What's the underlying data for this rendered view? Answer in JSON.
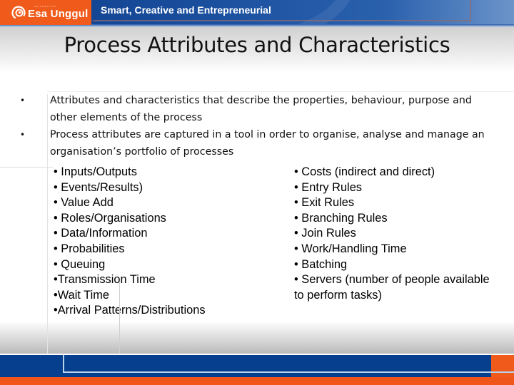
{
  "header": {
    "logo_text": "Esa Unggul",
    "logo_subtext": "UNIVERSITAS",
    "tagline": "Smart, Creative and Entrepreneurial",
    "logo_icon": "esa-unggul-logo-icon",
    "colors": {
      "brand_orange": "#f05a1a",
      "brand_blue": "#063f8d"
    }
  },
  "slide": {
    "title": "Process Attributes and Characteristics",
    "bullets": [
      {
        "marker": "•",
        "text": "Attributes and characteristics that describe the properties, behaviour, purpose and other elements of the process"
      },
      {
        "marker": "•",
        "text": "Process attributes are captured in a tool in order to organise, analyse and manage an organisation’s portfolio of processes"
      }
    ],
    "left_list": [
      "• Inputs/Outputs",
      "• Events/Results)",
      "• Value Add",
      "• Roles/Organisations",
      "• Data/Information",
      "• Probabilities",
      "• Queuing",
      "•Transmission Time",
      "•Wait Time",
      "•Arrival Patterns/Distributions"
    ],
    "right_list": [
      "• Costs (indirect and direct)",
      "• Entry Rules",
      "• Exit Rules",
      "• Branching Rules",
      "• Join Rules",
      "• Work/Handling Time",
      "• Batching",
      "• Servers (number of people available to perform tasks)"
    ]
  }
}
